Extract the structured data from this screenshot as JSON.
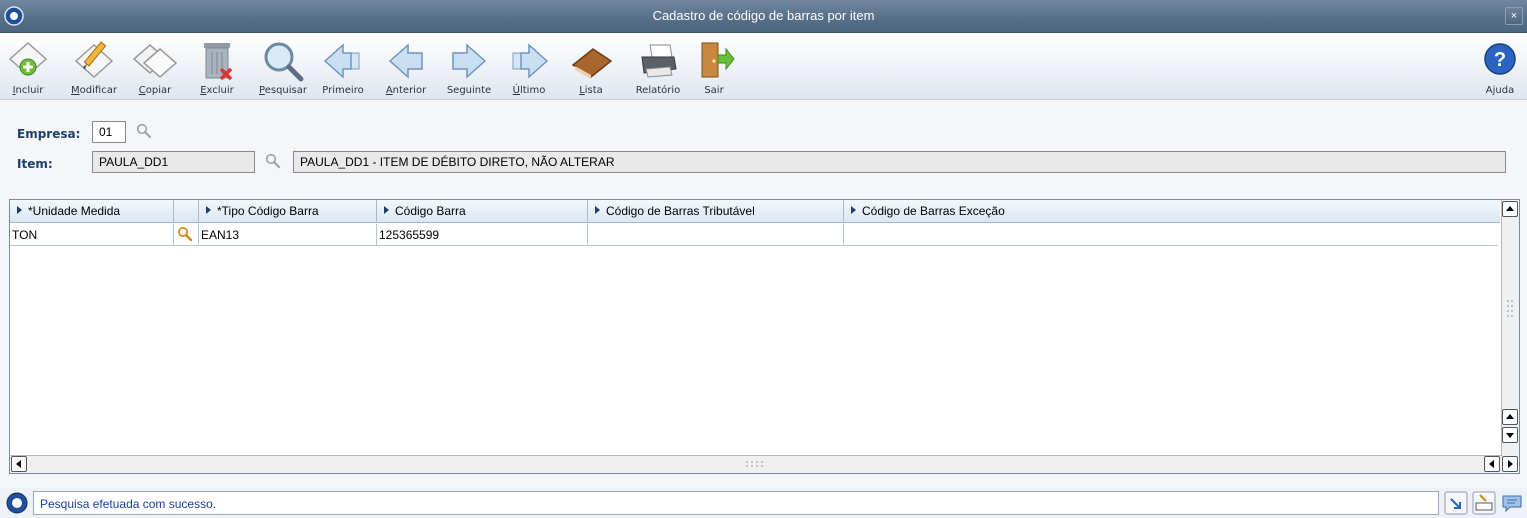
{
  "window": {
    "title": "Cadastro de código de barras por item",
    "close_label": "×"
  },
  "toolbar": {
    "buttons": [
      {
        "label": "Incluir",
        "icon": "add-icon"
      },
      {
        "label": "Modificar",
        "icon": "edit-icon"
      },
      {
        "label": "Copiar",
        "icon": "copy-icon"
      },
      {
        "label": "Excluir",
        "icon": "delete-icon"
      },
      {
        "label": "Pesquisar",
        "icon": "search-icon"
      },
      {
        "label": "Primeiro",
        "icon": "first-icon"
      },
      {
        "label": "Anterior",
        "icon": "previous-icon"
      },
      {
        "label": "Seguinte",
        "icon": "next-icon"
      },
      {
        "label": "Último",
        "icon": "last-icon"
      },
      {
        "label": "Lista",
        "icon": "list-icon"
      },
      {
        "label": "Relatório",
        "icon": "printer-icon"
      },
      {
        "label": "Sair",
        "icon": "exit-icon"
      }
    ],
    "help_label": "Ajuda"
  },
  "form": {
    "empresa_label": "Empresa:",
    "empresa_value": "01",
    "item_label": "Item:",
    "item_code": "PAULA_DD1",
    "item_description": "PAULA_DD1 - ITEM DE DÉBITO DIRETO, NÃO ALTERAR"
  },
  "grid": {
    "columns": [
      "*Unidade Medida",
      "*Tipo Código Barra",
      "Código Barra",
      "Código de Barras Tributável",
      "Código de Barras Exceção"
    ],
    "rows": [
      {
        "unidade": "TON",
        "tipo": "EAN13",
        "codigo": "125365599",
        "tributavel": "",
        "excecao": ""
      }
    ]
  },
  "status": {
    "message": "Pesquisa efetuada com sucesso."
  },
  "colors": {
    "title_bar": "#566f88",
    "label_blue": "#1f3f6b",
    "status_text": "#1c3c9c"
  }
}
